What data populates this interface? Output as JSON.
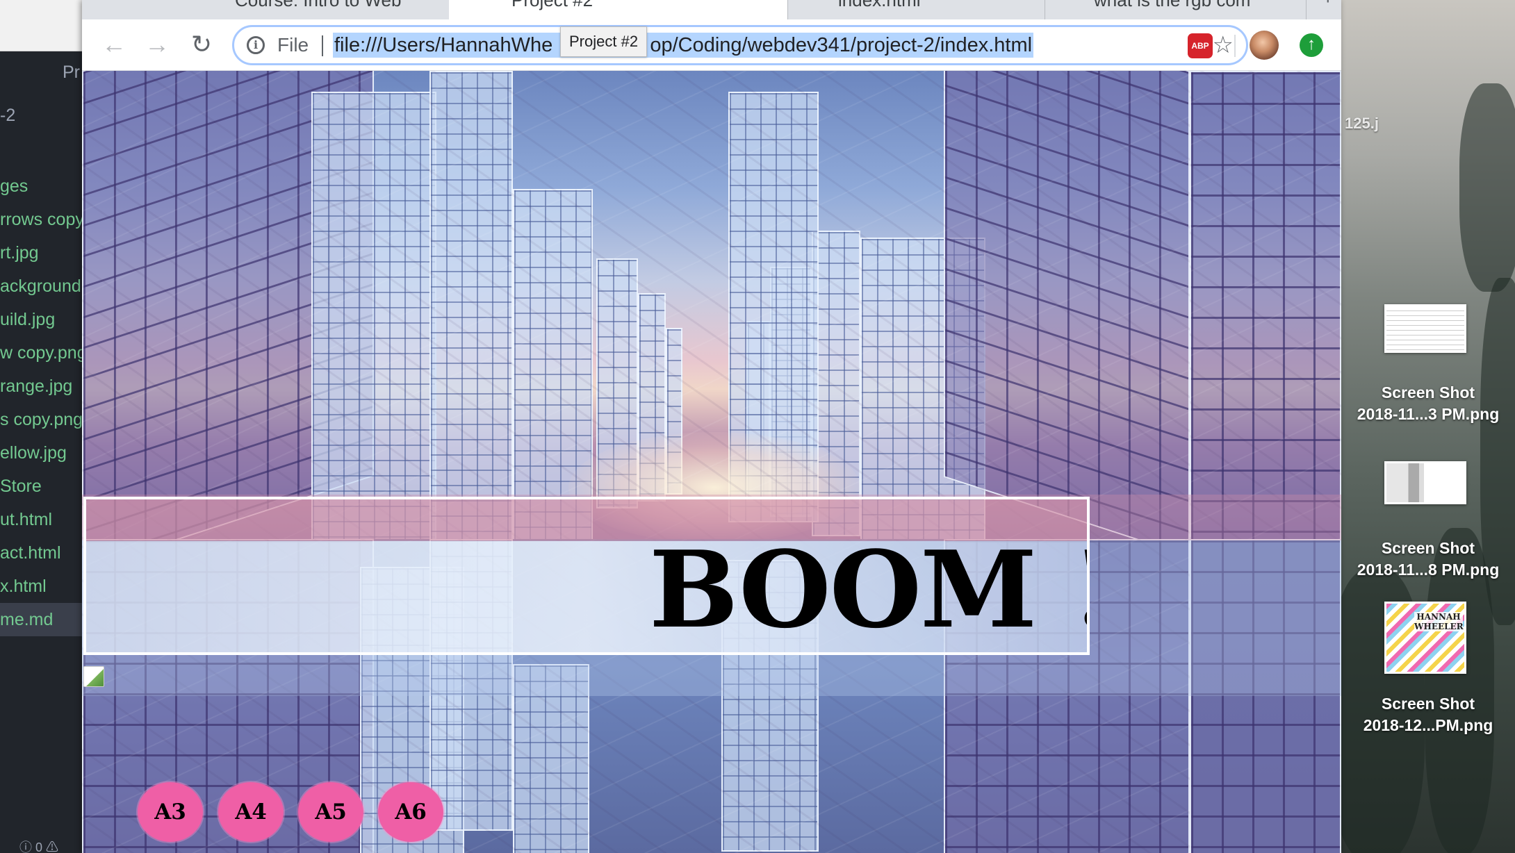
{
  "editor": {
    "title_fragment": "Pr",
    "project_fragment": "-2",
    "files": [
      "ges",
      "rrows copy",
      "rt.jpg",
      "ackground",
      "uild.jpg",
      "w copy.png",
      "range.jpg",
      "s copy.png",
      "ellow.jpg",
      "Store",
      "ut.html",
      "act.html",
      "x.html",
      "me.md"
    ],
    "selected_file_index": 13,
    "status_fragment": "ⓘ 0 ⚠"
  },
  "browser": {
    "tabs": [
      {
        "label": "Course: Intro to Web",
        "active": false,
        "icon": "tab-favicon-icon"
      },
      {
        "label": "Project #2",
        "active": true,
        "icon": "page-icon"
      },
      {
        "label": "index.html",
        "active": false,
        "icon": "page-icon"
      },
      {
        "label": "what is the rgb com",
        "active": false,
        "icon": "google-icon"
      }
    ],
    "new_tab": "+",
    "nav": {
      "back": "←",
      "forward": "→",
      "reload": "↻"
    },
    "omnibox": {
      "info_icon": "i",
      "scheme_label": "File",
      "url_before": "file:///Users/HannahWhe",
      "url_after": "op/Coding/webdev341/project-2/index.html",
      "star": "☆"
    },
    "tooltip": "Project #2",
    "extensions": {
      "abp": "ABP",
      "green": "↑"
    }
  },
  "page": {
    "banner_text": "BOOM !",
    "buttons": [
      "A3",
      "A4",
      "A5",
      "A6"
    ]
  },
  "desktop": {
    "top_fragment": "125.j",
    "files": [
      {
        "line1": "Screen Shot",
        "line2": "2018-11...3 PM.png"
      },
      {
        "line1": "Screen Shot",
        "line2": "2018-11...8 PM.png"
      },
      {
        "line1": "Screen Shot",
        "line2": "2018-12...PM.png"
      }
    ],
    "thumb3_text": "HANNAH\nWHEELER"
  }
}
